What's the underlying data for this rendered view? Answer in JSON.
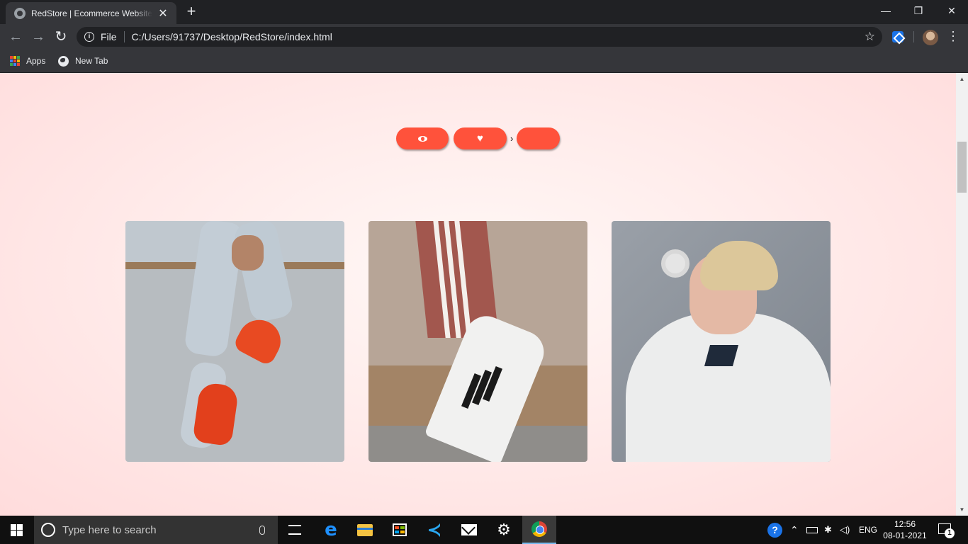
{
  "browser": {
    "tab_title": "RedStore | Ecommerce Website Design",
    "url_scheme": "File",
    "url": "C:/Users/91737/Desktop/RedStore/index.html",
    "bookmarks": [
      {
        "label": "Apps",
        "icon": "apps-grid-icon"
      },
      {
        "label": "New Tab",
        "icon": "globe-icon"
      }
    ]
  },
  "page": {
    "accent_color": "#ff523b",
    "action_buttons": [
      {
        "name": "view",
        "icon": "eye-icon"
      },
      {
        "name": "wishlist",
        "icon": "heart-icon"
      },
      {
        "name": "cart",
        "icon": ""
      }
    ],
    "separator_glyph": "›",
    "photos": [
      {
        "name": "model-red-sneakers-photo"
      },
      {
        "name": "adidas-superstar-shoe-photo"
      },
      {
        "name": "woman-adidas-hoodie-photo"
      }
    ]
  },
  "taskbar": {
    "search_placeholder": "Type here to search",
    "language": "ENG",
    "time": "12:56",
    "date": "08-01-2021",
    "notification_count": "1"
  }
}
